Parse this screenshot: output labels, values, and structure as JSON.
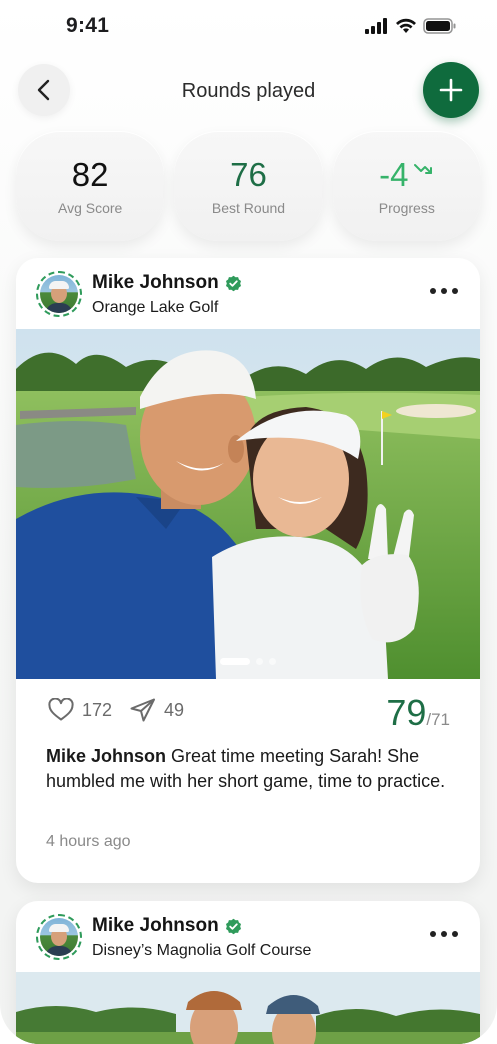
{
  "status_bar": {
    "time": "9:41"
  },
  "header": {
    "title": "Rounds played"
  },
  "stats": [
    {
      "value": "82",
      "label": "Avg Score"
    },
    {
      "value": "76",
      "label": "Best Round"
    },
    {
      "value": "-4",
      "label": "Progress"
    }
  ],
  "posts": [
    {
      "user": "Mike Johnson",
      "course": "Orange Lake Golf",
      "likes": "172",
      "shares": "49",
      "score": "79",
      "par": "/71",
      "caption_user": "Mike Johnson",
      "caption_text": " Great time meeting Sarah! She humbled me with her short game, time to practice.",
      "time_ago": "4 hours ago",
      "photo_pages": 3,
      "photo_active_page": 1
    },
    {
      "user": "Mike Johnson",
      "course": "Disney’s Magnolia Golf Course"
    }
  ],
  "colors": {
    "brand_green": "#0f6b3d",
    "score_green": "#1e6e46",
    "progress_green": "#36b36a",
    "verified_green": "#2f9b5b"
  },
  "icons": [
    "back-chevron-icon",
    "plus-icon",
    "trend-down-icon",
    "verified-badge-icon",
    "more-dots-icon",
    "heart-icon",
    "send-icon",
    "signal-icon",
    "wifi-icon",
    "battery-icon"
  ]
}
